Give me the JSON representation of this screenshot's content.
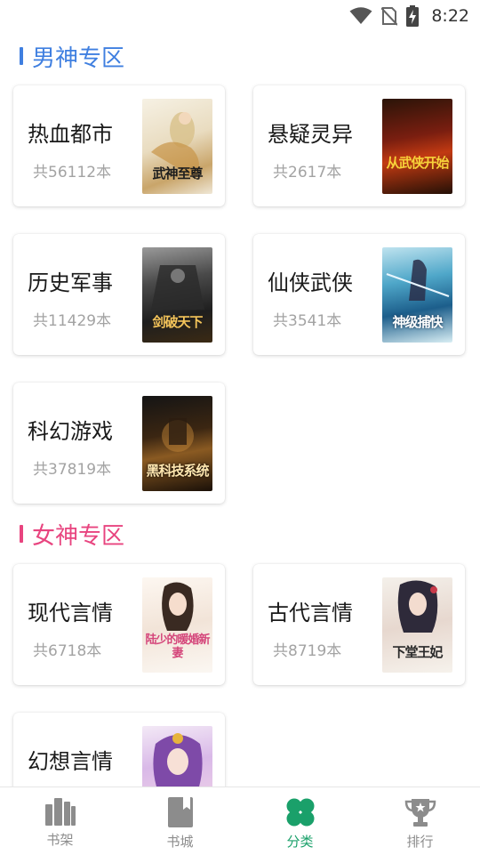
{
  "status_bar": {
    "time": "8:22"
  },
  "colors": {
    "male_accent": "#3f7fe0",
    "female_accent": "#e8447f",
    "tab_active": "#1aa06a",
    "tab_inactive": "#8c8c8c"
  },
  "sections": [
    {
      "title": "男神专区",
      "categories": [
        {
          "name": "热血都市",
          "count": "共56112本",
          "cover_text": "武神至尊"
        },
        {
          "name": "悬疑灵异",
          "count": "共2617本",
          "cover_text": "从武侠开始"
        },
        {
          "name": "历史军事",
          "count": "共11429本",
          "cover_text": "剑破天下"
        },
        {
          "name": "仙侠武侠",
          "count": "共3541本",
          "cover_text": "神级捕快"
        },
        {
          "name": "科幻游戏",
          "count": "共37819本",
          "cover_text": "黑科技系统"
        }
      ]
    },
    {
      "title": "女神专区",
      "categories": [
        {
          "name": "现代言情",
          "count": "共6718本",
          "cover_text": "陆少的暖婚新妻"
        },
        {
          "name": "古代言情",
          "count": "共8719本",
          "cover_text": "下堂王妃"
        },
        {
          "name": "幻想言情",
          "count": "",
          "cover_text": ""
        }
      ]
    }
  ],
  "tabs": [
    {
      "label": "书架",
      "icon": "bookshelf-icon"
    },
    {
      "label": "书城",
      "icon": "book-icon"
    },
    {
      "label": "分类",
      "icon": "clover-icon",
      "active": true
    },
    {
      "label": "排行",
      "icon": "trophy-icon"
    }
  ]
}
